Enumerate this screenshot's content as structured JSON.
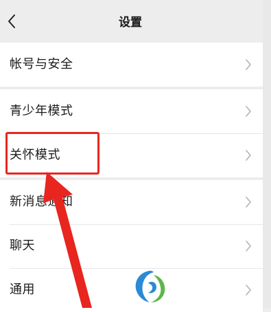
{
  "nav": {
    "title": "设置",
    "back_icon": "chevron-left-icon"
  },
  "sections": [
    {
      "items": [
        {
          "label": "帐号与安全",
          "icon": "chevron-right-icon"
        }
      ]
    },
    {
      "items": [
        {
          "label": "青少年模式",
          "icon": "chevron-right-icon"
        },
        {
          "label": "关怀模式",
          "icon": "chevron-right-icon"
        }
      ]
    },
    {
      "items": [
        {
          "label": "新消息通知",
          "icon": "chevron-right-icon"
        },
        {
          "label": "聊天",
          "icon": "chevron-right-icon"
        },
        {
          "label": "通用",
          "icon": "chevron-right-icon"
        }
      ]
    }
  ],
  "annotation": {
    "highlight_color": "#e8251f",
    "highlighted_item": "关怀模式"
  },
  "colors": {
    "page_background": "#ededed",
    "row_background": "#ffffff",
    "text": "#1b1b1b",
    "chevron": "#b2b2b2"
  }
}
